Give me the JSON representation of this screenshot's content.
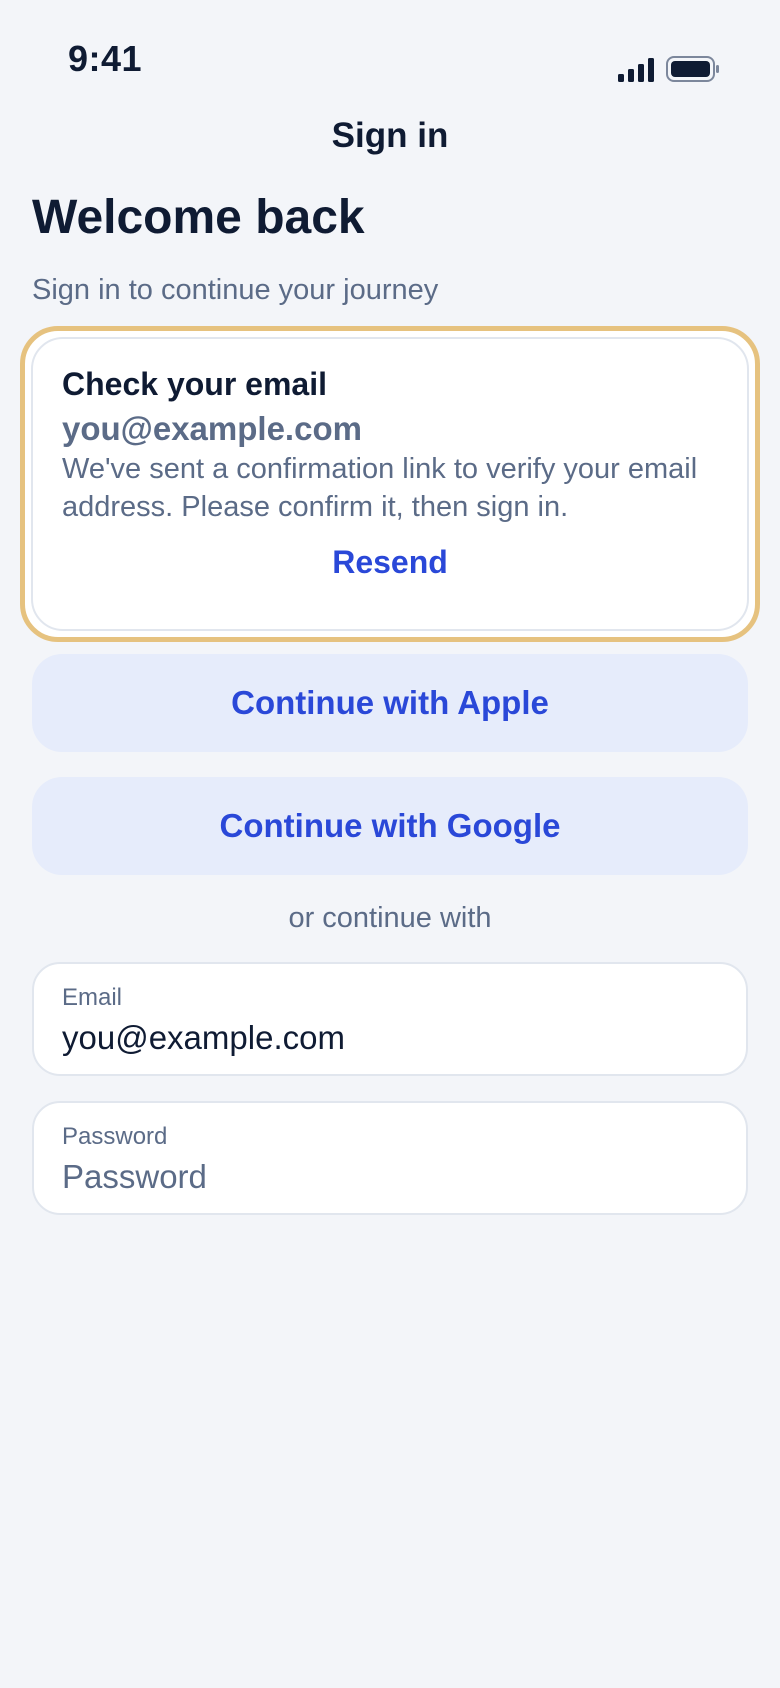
{
  "status_bar": {
    "time": "9:41",
    "signal_icon": "cellular-signal-icon",
    "battery_icon": "battery-icon"
  },
  "nav": {
    "title": "Sign in"
  },
  "header": {
    "title": "Welcome back",
    "subtitle": "Sign in to continue your journey"
  },
  "notice": {
    "title": "Check your email",
    "email": "you@example.com",
    "body": "We've sent a confirmation link to verify your email address. Please confirm it, then sign in.",
    "action_label": "Resend",
    "border_color": "#e6c27f"
  },
  "social": {
    "apple_label": "Continue with Apple",
    "google_label": "Continue with Google"
  },
  "divider_text": "or continue with",
  "form": {
    "email": {
      "label": "Email",
      "value": "you@example.com",
      "placeholder": ""
    },
    "password": {
      "label": "Password",
      "value": "",
      "placeholder": "Password"
    }
  },
  "colors": {
    "accent": "#2a48d8",
    "background": "#f3f5f9",
    "button_bg": "#e6ecfb",
    "text_primary": "#0f1b33",
    "text_secondary": "#5b6b87"
  }
}
